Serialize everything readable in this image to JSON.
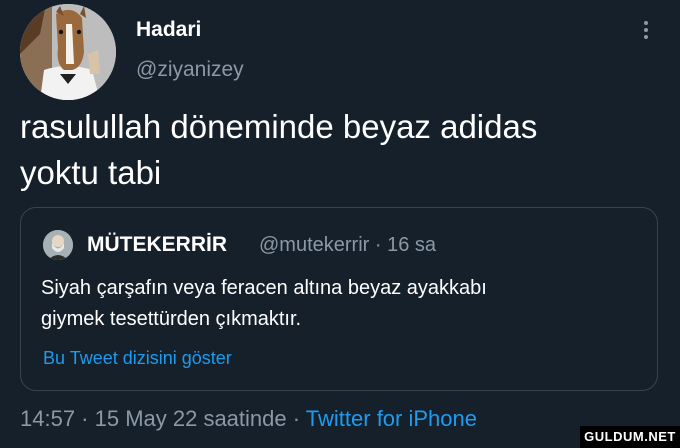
{
  "author": {
    "name": "Hadari",
    "handle": "@ziyanizey",
    "avatar_icon": "horse-mask-avatar-icon"
  },
  "more_icon": "vertical-dots-icon",
  "tweet": {
    "text": "rasulullah döneminde beyaz adidas\nyoktu tabi"
  },
  "quoted_tweet": {
    "name": "MÜTEKERRİR",
    "handle": "@mutekerrir",
    "separator": "·",
    "time": "16 sa",
    "text": "Siyah çarşafın veya feracen altına beyaz ayakkabı\ngiymek tesettürden çıkmaktır.",
    "show_thread_link": "Bu Tweet dizisini göster"
  },
  "footer": {
    "timestamp": "14:57 · 15 May 22 saatinde",
    "separator": "·",
    "source": "Twitter for iPhone"
  },
  "watermark": "GULDUM.NET",
  "colors": {
    "background": "#15202b",
    "secondary_text": "#8b98a5",
    "link": "#1d9bf0",
    "border": "#38444d"
  }
}
